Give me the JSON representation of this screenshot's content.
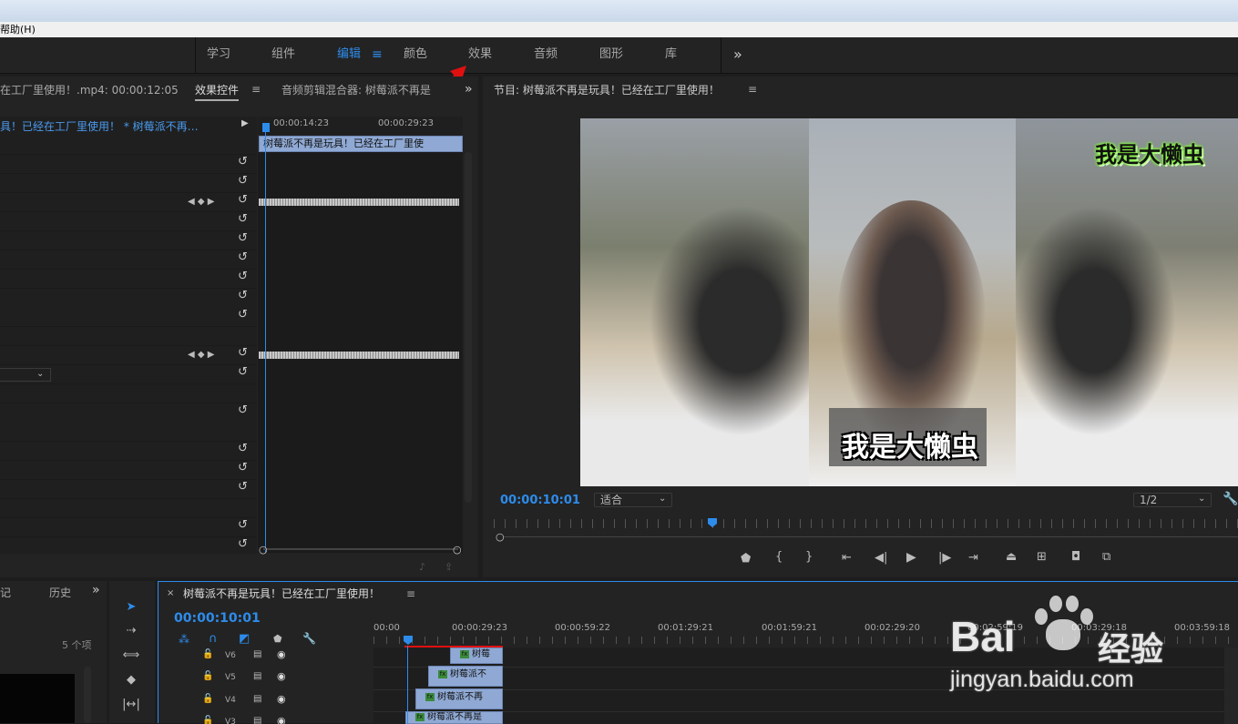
{
  "menubar": {
    "help": "帮助(H)"
  },
  "workspaces": {
    "items": [
      "学习",
      "组件",
      "编辑",
      "颜色",
      "效果",
      "音频",
      "图形",
      "库"
    ],
    "active_index": 2,
    "more": "»"
  },
  "source_panel": {
    "clip_info": "在工厂里使用！.mp4: 00:00:12:05",
    "tab_effect_controls": "效果控件",
    "tab_audio_mixer": "音频剪辑混合器: 树莓派不再是",
    "breadcrumb": "具！已经在工厂里使用！ * 树莓派不再…",
    "time_a": "00:00:14:23",
    "time_b": "00:00:29:23",
    "clip_name": "树莓派不再是玩具！已经在工厂里使"
  },
  "program_monitor": {
    "title": "节目: 树莓派不再是玩具！已经在工厂里使用！",
    "caption_big": "我是大懒虫",
    "caption_small": "我是大懒虫",
    "timecode": "00:00:10:01",
    "fit": "适合",
    "resolution": "1/2"
  },
  "history_panel": {
    "tab_a": "记",
    "tab_b": "历史",
    "count": "5 个项"
  },
  "timeline": {
    "title": "树莓派不再是玩具！已经在工厂里使用！",
    "timecode": "00:00:10:01",
    "ruler": [
      "00:00",
      "00:00:29:23",
      "00:00:59:22",
      "00:01:29:21",
      "00:01:59:21",
      "00:02:29:20",
      "00:02:59:19",
      "00:03:29:18",
      "00:03:59:18"
    ],
    "tracks": [
      {
        "name": "V6",
        "clip": "树莓"
      },
      {
        "name": "V5",
        "clip": "树莓派不"
      },
      {
        "name": "V4",
        "clip": "树莓派不再"
      },
      {
        "name": "V3",
        "clip": "树莓派不再是"
      }
    ]
  },
  "watermark": {
    "brand": "Bai",
    "brand2": "经验",
    "url": "jingyan.baidu.com"
  },
  "colors": {
    "accent": "#2d8ceb",
    "clip": "#8fa9d4",
    "arrow": "#e01010"
  }
}
